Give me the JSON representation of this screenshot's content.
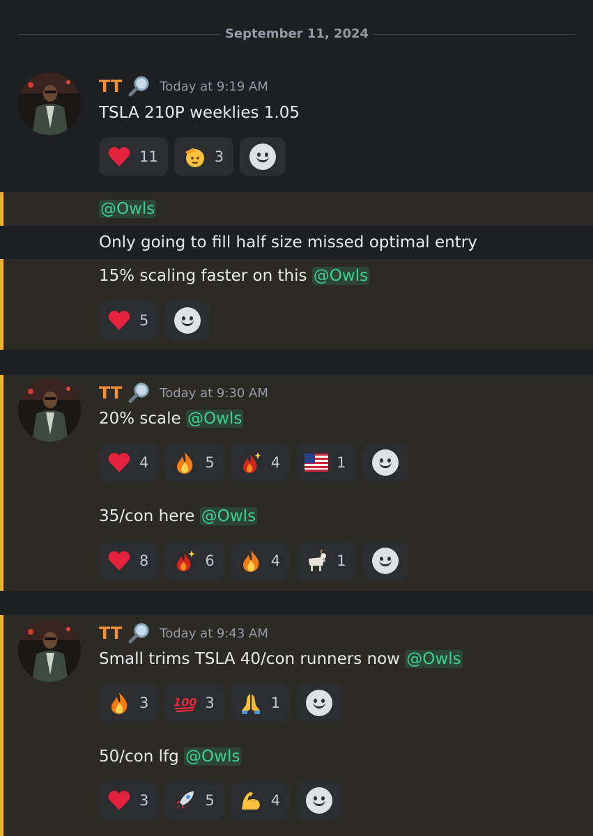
{
  "date_divider": "September 11, 2024",
  "user": {
    "name": "TT",
    "badge": "magnifier-icon"
  },
  "msg1": {
    "time": "Today at 9:19 AM",
    "text": "TSLA 210P weeklies 1.05",
    "reactions": [
      {
        "emoji": "heart",
        "count": "11"
      },
      {
        "emoji": "saluting-face",
        "count": "3"
      }
    ]
  },
  "msg2": {
    "mention": "@Owls",
    "line1": "Only going to fill half size missed optimal entry",
    "line2_text": "15% scaling faster on this ",
    "line2_mention": "@Owls",
    "reactions": [
      {
        "emoji": "heart",
        "count": "5"
      }
    ]
  },
  "msg3": {
    "time": "Today at 9:30 AM",
    "text": "20% scale ",
    "mention": "@Owls",
    "reactions": [
      {
        "emoji": "heart",
        "count": "4"
      },
      {
        "emoji": "fire",
        "count": "5"
      },
      {
        "emoji": "fire-sparkle",
        "count": "4"
      },
      {
        "emoji": "us-flag",
        "count": "1"
      }
    ]
  },
  "msg4": {
    "text": "35/con here ",
    "mention": "@Owls",
    "reactions": [
      {
        "emoji": "heart",
        "count": "8"
      },
      {
        "emoji": "fire-sparkle",
        "count": "6"
      },
      {
        "emoji": "fire",
        "count": "4"
      },
      {
        "emoji": "goat",
        "count": "1"
      }
    ]
  },
  "msg5": {
    "time": "Today at 9:43 AM",
    "text": "Small trims TSLA 40/con runners now ",
    "mention": "@Owls",
    "reactions": [
      {
        "emoji": "fire",
        "count": "3"
      },
      {
        "emoji": "hundred",
        "count": "3"
      },
      {
        "emoji": "praying-hands",
        "count": "1"
      }
    ]
  },
  "msg6": {
    "text": "50/con lfg ",
    "mention": "@Owls",
    "reactions": [
      {
        "emoji": "heart",
        "count": "3"
      },
      {
        "emoji": "rocket",
        "count": "5"
      },
      {
        "emoji": "flexed-biceps",
        "count": "4"
      }
    ]
  },
  "colors": {
    "highlight_bar": "#f0b232",
    "username": "#f0903a",
    "mention": "#3fd18f"
  }
}
